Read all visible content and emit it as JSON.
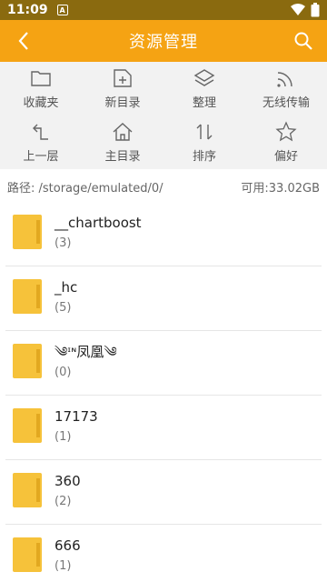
{
  "status": {
    "time": "11:09",
    "note_icon": "A"
  },
  "header": {
    "title": "资源管理"
  },
  "toolbar": [
    {
      "label": "收藏夹",
      "icon": "folder-icon"
    },
    {
      "label": "新目录",
      "icon": "new-folder-icon"
    },
    {
      "label": "整理",
      "icon": "layers-icon"
    },
    {
      "label": "无线传输",
      "icon": "wireless-icon"
    },
    {
      "label": "上一层",
      "icon": "up-level-icon"
    },
    {
      "label": "主目录",
      "icon": "home-icon"
    },
    {
      "label": "排序",
      "icon": "sort-icon"
    },
    {
      "label": "偏好",
      "icon": "star-icon"
    }
  ],
  "path": {
    "label": "路径: /storage/emulated/0/",
    "free": "可用:33.02GB"
  },
  "files": [
    {
      "name": "__chartboost",
      "count": "(3)"
    },
    {
      "name": "_hc",
      "count": "(5)"
    },
    {
      "name": "༄ᶦᶰ凤凰༄",
      "count": "(0)"
    },
    {
      "name": "17173",
      "count": "(1)"
    },
    {
      "name": "360",
      "count": "(2)"
    },
    {
      "name": "666",
      "count": "(1)"
    }
  ],
  "colors": {
    "accent": "#f5a313",
    "status_bar": "#8a6a0f",
    "folder": "#f6c23a"
  }
}
